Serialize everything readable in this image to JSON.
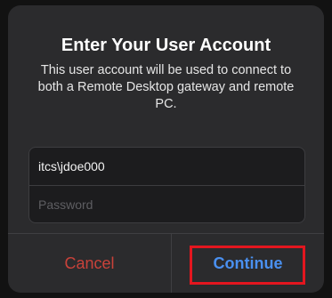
{
  "dialog": {
    "title": "Enter Your User Account",
    "message": "This user account will be used to connect to both a Remote Desktop gateway and remote PC.",
    "username": {
      "value": "itcs\\jdoe000",
      "placeholder": ""
    },
    "password": {
      "value": "",
      "placeholder": "Password"
    },
    "cancel_label": "Cancel",
    "continue_label": "Continue"
  },
  "colors": {
    "dialog_bg": "#2b2b2d",
    "cancel_text": "#c9423a",
    "continue_text": "#4a90f0",
    "highlight": "#e3161f"
  }
}
